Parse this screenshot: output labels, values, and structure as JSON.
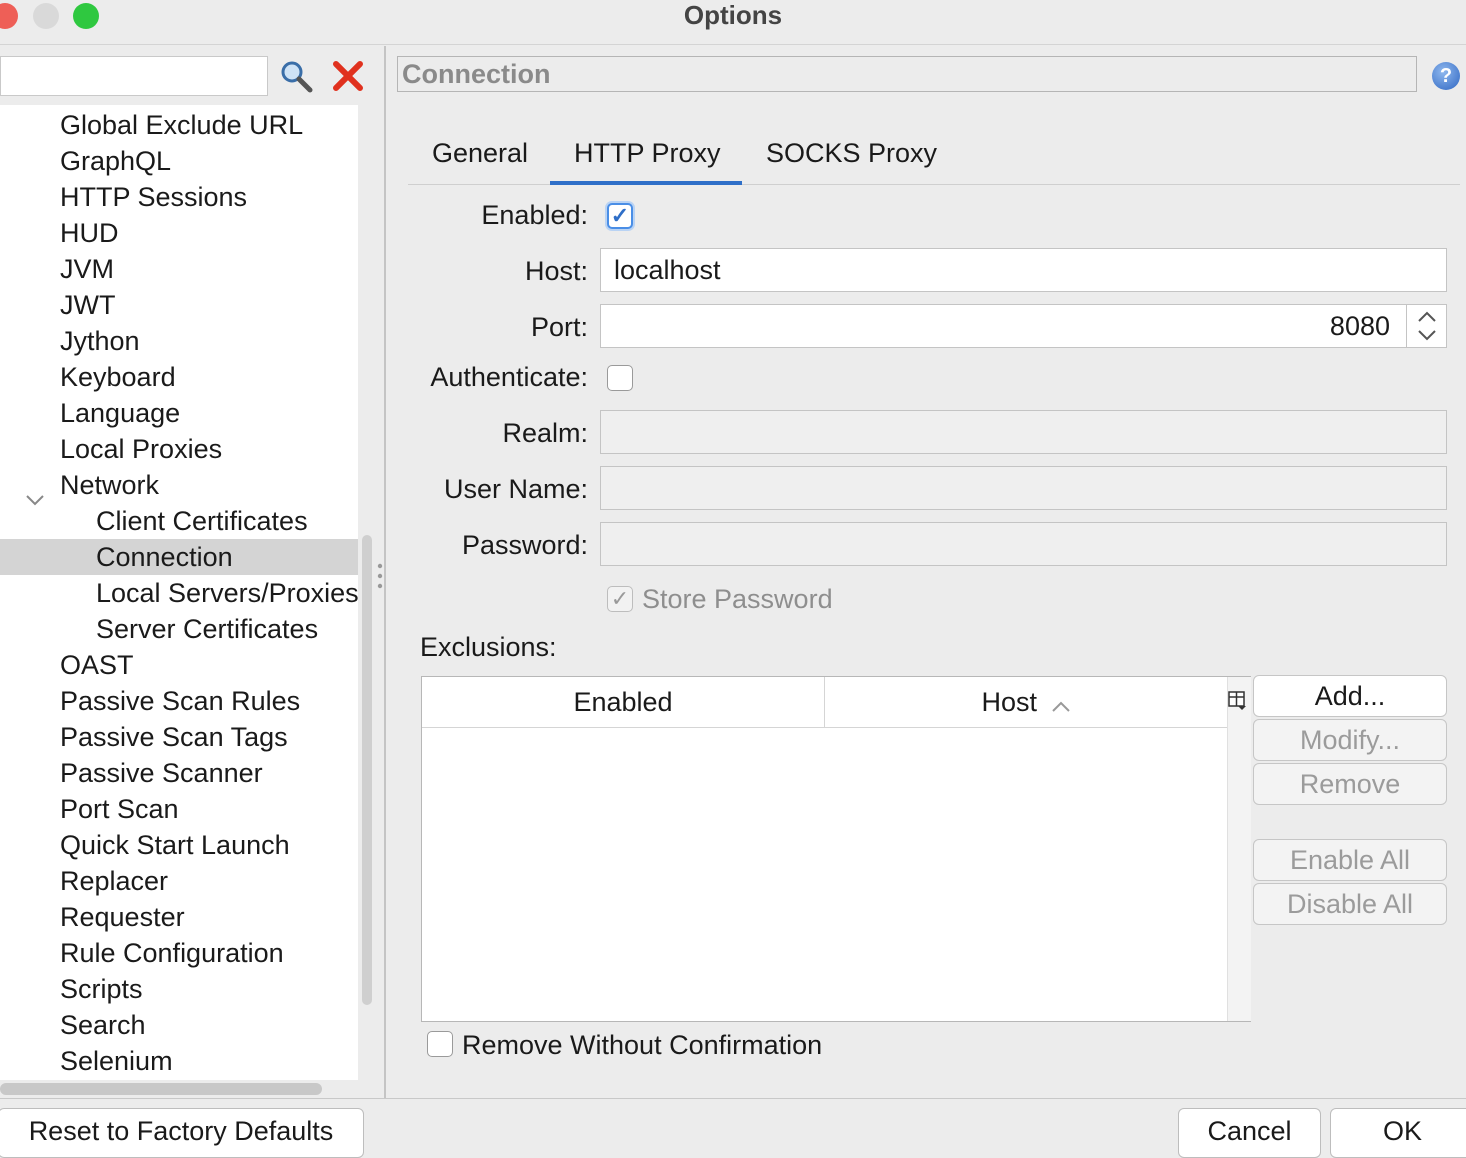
{
  "window": {
    "title": "Options",
    "controls": {
      "close_color": "#ee5f57",
      "minimize_color": "#d9d9d9",
      "maximize_color": "#2fc840"
    }
  },
  "search": {
    "value": "",
    "search_icon": "magnifier-icon",
    "clear_icon": "red-x-icon"
  },
  "tree": {
    "items": [
      {
        "label": "Global Exclude URL",
        "level": 1
      },
      {
        "label": "GraphQL",
        "level": 1
      },
      {
        "label": "HTTP Sessions",
        "level": 1
      },
      {
        "label": "HUD",
        "level": 1
      },
      {
        "label": "JVM",
        "level": 1
      },
      {
        "label": "JWT",
        "level": 1
      },
      {
        "label": "Jython",
        "level": 1
      },
      {
        "label": "Keyboard",
        "level": 1
      },
      {
        "label": "Language",
        "level": 1
      },
      {
        "label": "Local Proxies",
        "level": 1
      },
      {
        "label": "Network",
        "level": 1,
        "expanded": true
      },
      {
        "label": "Client Certificates",
        "level": 2
      },
      {
        "label": "Connection",
        "level": 2,
        "selected": true
      },
      {
        "label": "Local Servers/Proxies",
        "level": 2
      },
      {
        "label": "Server Certificates",
        "level": 2
      },
      {
        "label": "OAST",
        "level": 1
      },
      {
        "label": "Passive Scan Rules",
        "level": 1
      },
      {
        "label": "Passive Scan Tags",
        "level": 1
      },
      {
        "label": "Passive Scanner",
        "level": 1
      },
      {
        "label": "Port Scan",
        "level": 1
      },
      {
        "label": "Quick Start Launch",
        "level": 1
      },
      {
        "label": "Replacer",
        "level": 1
      },
      {
        "label": "Requester",
        "level": 1
      },
      {
        "label": "Rule Configuration",
        "level": 1
      },
      {
        "label": "Scripts",
        "level": 1
      },
      {
        "label": "Search",
        "level": 1
      },
      {
        "label": "Selenium",
        "level": 1
      }
    ]
  },
  "panel": {
    "title": "Connection",
    "help_icon": "help-icon",
    "tabs": [
      {
        "label": "General",
        "active": false
      },
      {
        "label": "HTTP Proxy",
        "active": true
      },
      {
        "label": "SOCKS Proxy",
        "active": false
      }
    ],
    "form": {
      "enabled_label": "Enabled:",
      "enabled_checked": true,
      "host_label": "Host:",
      "host_value": "localhost",
      "port_label": "Port:",
      "port_value": "8080",
      "authenticate_label": "Authenticate:",
      "authenticate_checked": false,
      "realm_label": "Realm:",
      "realm_value": "",
      "username_label": "User Name:",
      "username_value": "",
      "password_label": "Password:",
      "password_value": "",
      "store_password_label": "Store Password",
      "store_password_checked": true
    },
    "exclusions": {
      "label": "Exclusions:",
      "columns": [
        "Enabled",
        "Host"
      ],
      "sort_column": "Host",
      "rows": [],
      "buttons": {
        "add": "Add...",
        "modify": "Modify...",
        "remove": "Remove",
        "enable_all": "Enable All",
        "disable_all": "Disable All"
      },
      "remove_without_confirmation_label": "Remove Without Confirmation",
      "remove_without_confirmation_checked": false
    }
  },
  "footer": {
    "reset": "Reset to Factory Defaults",
    "cancel": "Cancel",
    "ok": "OK"
  }
}
